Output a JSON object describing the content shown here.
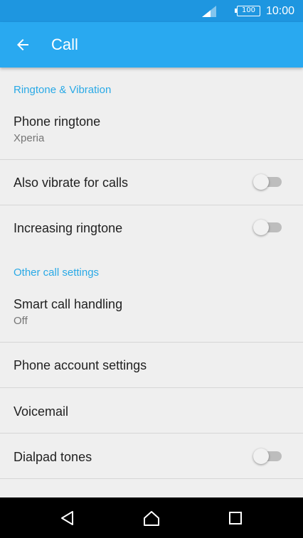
{
  "status_bar": {
    "battery": "100",
    "time": "10:00"
  },
  "app_bar": {
    "title": "Call",
    "back_icon": "arrow-left-icon"
  },
  "sections": {
    "ringtone_header": "Ringtone & Vibration",
    "other_header": "Other call settings"
  },
  "items": {
    "phone_ringtone": {
      "title": "Phone ringtone",
      "value": "Xperia"
    },
    "also_vibrate": {
      "title": "Also vibrate for calls",
      "enabled": false
    },
    "increasing_ringtone": {
      "title": "Increasing ringtone",
      "enabled": false
    },
    "smart_call_handling": {
      "title": "Smart call handling",
      "value": "Off"
    },
    "phone_account_settings": {
      "title": "Phone account settings"
    },
    "voicemail": {
      "title": "Voicemail"
    },
    "dialpad_tones": {
      "title": "Dialpad tones",
      "enabled": false
    }
  },
  "nav_bar": {
    "back_icon": "triangle-back-icon",
    "home_icon": "home-icon",
    "recents_icon": "square-recents-icon"
  },
  "colors": {
    "status_bar": "#1e96e0",
    "app_bar": "#29a9f0",
    "accent": "#29a9e6",
    "background": "#efefef"
  }
}
